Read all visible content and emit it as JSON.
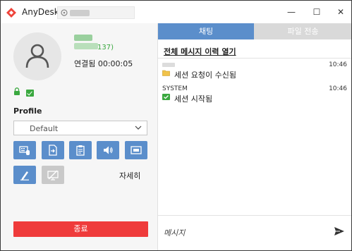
{
  "app": {
    "title": "AnyDesk",
    "accent": "#ef443b"
  },
  "window_controls": {
    "minimize": "—",
    "maximize": "☐",
    "close": "✕"
  },
  "peer": {
    "id_suffix": "137)",
    "status": "연결됨 00:00:05"
  },
  "profile": {
    "label": "Profile",
    "selected": "Default"
  },
  "toolbar": {
    "buttons": [
      {
        "name": "keyboard-mouse-icon",
        "enabled": true
      },
      {
        "name": "file-transfer-icon",
        "enabled": true
      },
      {
        "name": "clipboard-icon",
        "enabled": true
      },
      {
        "name": "audio-icon",
        "enabled": true
      },
      {
        "name": "screen-icon",
        "enabled": true
      },
      {
        "name": "whiteboard-icon",
        "enabled": true
      },
      {
        "name": "display-off-icon",
        "enabled": false
      }
    ],
    "more_label": "자세히"
  },
  "end_button": {
    "label": "종료",
    "color": "#ef3b3b"
  },
  "chat": {
    "tabs": [
      {
        "label": "채팅",
        "active": true
      },
      {
        "label": "파일 전송",
        "active": false
      }
    ],
    "history_link": "전체 메시지 이력 열기",
    "messages": [
      {
        "sender": "",
        "time": "10:46",
        "text": "세션 요청이 수신됨",
        "icon": "folder-icon"
      },
      {
        "sender": "SYSTEM",
        "time": "10:46",
        "text": "세션 시작됨",
        "icon": "check-icon"
      }
    ],
    "input_placeholder": "메시지"
  },
  "colors": {
    "tab_active": "#5b8ecb",
    "tab_inactive": "#d9d9d9",
    "success": "#3aa83f"
  }
}
